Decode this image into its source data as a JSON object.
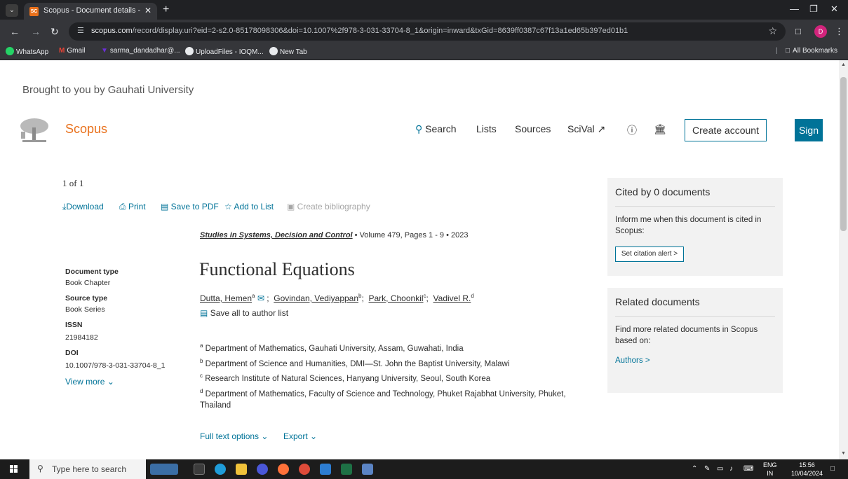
{
  "browser": {
    "tab_title": "Scopus - Document details - Fu",
    "tab_favicon": "SC",
    "url_domain": "scopus.com",
    "url_path": "/record/display.uri?eid=2-s2.0-85178098306&doi=10.1007%2f978-3-031-33704-8_1&origin=inward&txGid=8639ff0387c67f13a1ed65b397ed01b1",
    "profile_initial": "D",
    "bookmarks": [
      "WhatsApp",
      "Gmail",
      "sarma_dandadhar@...",
      "UploadFiles - IOQM...",
      "New Tab"
    ],
    "all_bookmarks": "All Bookmarks"
  },
  "header": {
    "brought_by": "Brought to you by Gauhati University",
    "logo": "Scopus",
    "nav": [
      "Search",
      "Lists",
      "Sources",
      "SciVal ↗"
    ],
    "create_account": "Create account",
    "sign_in": "Sign in"
  },
  "doc": {
    "counter": "1 of 1",
    "actions": [
      "Download",
      "Print",
      "Save to PDF",
      "Add to List",
      "Create bibliography"
    ],
    "source_title": "Studies in Systems, Decision and Control",
    "source_rest": " •  Volume 479, Pages 1 - 9  •  2023",
    "title": "Functional Equations",
    "authors": [
      {
        "name": "Dutta, Hemen",
        "sup": "a"
      },
      {
        "name": "Govindan, Vediyappan",
        "sup": "b"
      },
      {
        "name": "Park, Choonkil",
        "sup": "c"
      },
      {
        "name": "Vadivel R.",
        "sup": "d"
      }
    ],
    "save_authors": "Save all to author list",
    "affiliations": [
      {
        "sup": "a",
        "text": " Department of Mathematics, Gauhati University, Assam, Guwahati, India"
      },
      {
        "sup": "b",
        "text": " Department of Science and Humanities, DMI—St. John the Baptist University, Malawi"
      },
      {
        "sup": "c",
        "text": " Research Institute of Natural Sciences, Hanyang University, Seoul, South Korea"
      },
      {
        "sup": "d",
        "text": " Department of Mathematics, Faculty of Science and Technology, Phuket Rajabhat University, Phuket,"
      }
    ],
    "affil_cont": "Thailand",
    "full_text": "Full text options",
    "export": "Export"
  },
  "meta": {
    "doc_type_label": "Document type",
    "doc_type": "Book Chapter",
    "source_type_label": "Source type",
    "source_type": "Book Series",
    "issn_label": "ISSN",
    "issn": "21984182",
    "doi_label": "DOI",
    "doi": "10.1007/978-3-031-33704-8_1",
    "view_more": "View more"
  },
  "sidebar": {
    "cited_title": "Cited by 0 documents",
    "cited_text": "Inform me when this document is cited in Scopus:",
    "alert_button": "Set citation alert >",
    "related_title": "Related documents",
    "related_text": "Find more related documents in Scopus based on:",
    "authors_link": "Authors >"
  },
  "taskbar": {
    "search_placeholder": "Type here to search",
    "lang": "ENG",
    "region": "IN",
    "time": "15:56",
    "date": "10/04/2024"
  },
  "colors": {
    "accent": "#007398",
    "brand": "#e9711c"
  }
}
